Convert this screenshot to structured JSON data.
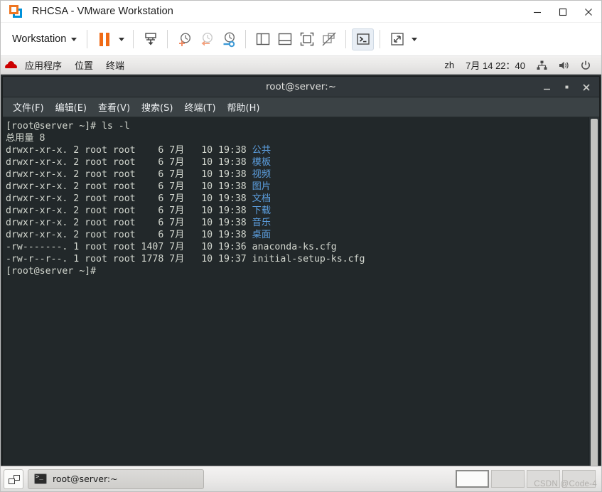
{
  "window": {
    "title": "RHCSA - VMware Workstation",
    "logo_icon": "vmware-logo-icon",
    "controls": {
      "minimize": "minimize-icon",
      "maximize": "maximize-icon",
      "close": "close-icon"
    }
  },
  "vm_toolbar": {
    "menu_label": "Workstation",
    "menu_caret": "chevron-down-icon",
    "buttons": [
      {
        "name": "suspend-vm-button",
        "icon": "pause-icon"
      },
      {
        "name": "suspend-dropdown-button",
        "icon": "chevron-down-icon"
      },
      {
        "name": "send-ctrl-alt-del-button",
        "icon": "send-key-icon"
      },
      {
        "name": "take-snapshot-button",
        "icon": "snapshot-add-icon"
      },
      {
        "name": "revert-snapshot-button",
        "icon": "snapshot-revert-icon"
      },
      {
        "name": "manage-snapshots-button",
        "icon": "snapshot-manager-icon"
      },
      {
        "name": "show-library-button",
        "icon": "library-panel-icon"
      },
      {
        "name": "show-thumbnail-bar-button",
        "icon": "thumbnail-bar-icon"
      },
      {
        "name": "enter-fullscreen-button",
        "icon": "fullscreen-icon"
      },
      {
        "name": "unity-mode-button",
        "icon": "unity-mode-disabled-icon"
      },
      {
        "name": "console-view-button",
        "icon": "console-view-icon"
      },
      {
        "name": "stretch-guest-button",
        "icon": "stretch-arrows-icon"
      },
      {
        "name": "stretch-dropdown-button",
        "icon": "chevron-down-icon"
      }
    ]
  },
  "gnome_panel": {
    "logo_icon": "redhat-logo-icon",
    "menus": [
      "应用程序",
      "位置",
      "终端"
    ],
    "input_method": "zh",
    "clock": "7月 14  22：40",
    "tray": [
      {
        "name": "network-icon",
        "glyph": "network"
      },
      {
        "name": "volume-icon",
        "glyph": "volume"
      },
      {
        "name": "power-icon",
        "glyph": "power"
      }
    ]
  },
  "terminal": {
    "title": "root@server:~",
    "controls": {
      "minimize": "_",
      "maximize": "▪",
      "close": "✕"
    },
    "menus": [
      "文件(F)",
      "编辑(E)",
      "查看(V)",
      "搜索(S)",
      "终端(T)",
      "帮助(H)"
    ],
    "lines": [
      {
        "text": "[root@server ~]# ls -l"
      },
      {
        "text": "总用量 8"
      },
      {
        "prefix": "drwxr-xr-x. 2 root root    6 7月   10 19:38 ",
        "name": "公共",
        "dir": true
      },
      {
        "prefix": "drwxr-xr-x. 2 root root    6 7月   10 19:38 ",
        "name": "模板",
        "dir": true
      },
      {
        "prefix": "drwxr-xr-x. 2 root root    6 7月   10 19:38 ",
        "name": "视频",
        "dir": true
      },
      {
        "prefix": "drwxr-xr-x. 2 root root    6 7月   10 19:38 ",
        "name": "图片",
        "dir": true
      },
      {
        "prefix": "drwxr-xr-x. 2 root root    6 7月   10 19:38 ",
        "name": "文档",
        "dir": true
      },
      {
        "prefix": "drwxr-xr-x. 2 root root    6 7月   10 19:38 ",
        "name": "下载",
        "dir": true
      },
      {
        "prefix": "drwxr-xr-x. 2 root root    6 7月   10 19:38 ",
        "name": "音乐",
        "dir": true
      },
      {
        "prefix": "drwxr-xr-x. 2 root root    6 7月   10 19:38 ",
        "name": "桌面",
        "dir": true
      },
      {
        "text": "-rw-------. 1 root root 1407 7月   10 19:36 anaconda-ks.cfg"
      },
      {
        "text": "-rw-r--r--. 1 root root 1778 7月   10 19:37 initial-setup-ks.cfg"
      },
      {
        "text": "[root@server ~]#"
      }
    ]
  },
  "taskbar": {
    "show_desktop_icon": "show-desktop-icon",
    "task": {
      "icon": "terminal-icon",
      "label": "root@server:~"
    },
    "workspaces": [
      {
        "active": true
      },
      {
        "active": false
      },
      {
        "active": false
      },
      {
        "active": false
      }
    ]
  },
  "watermark": "CSDN @Code-4",
  "colors": {
    "vmware_orange": "#ef7622",
    "vmware_blue": "#0091da",
    "redhat_red": "#cc0000",
    "terminal_bg": "#22282a",
    "terminal_fg": "#d3d7cf",
    "dir_blue": "#5c9fe0"
  }
}
